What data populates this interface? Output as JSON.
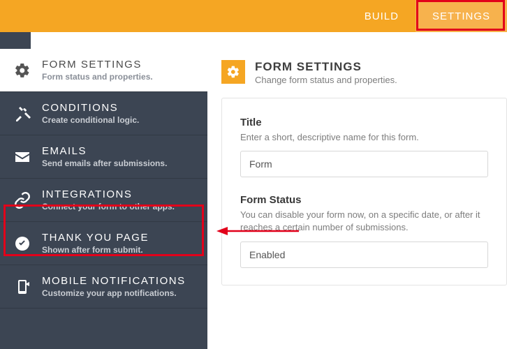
{
  "topbar": {
    "build": "BUILD",
    "settings": "SETTINGS"
  },
  "sidebar": {
    "items": [
      {
        "title": "FORM SETTINGS",
        "sub": "Form status and properties."
      },
      {
        "title": "CONDITIONS",
        "sub": "Create conditional logic."
      },
      {
        "title": "EMAILS",
        "sub": "Send emails after submissions."
      },
      {
        "title": "INTEGRATIONS",
        "sub": "Connect your form to other apps."
      },
      {
        "title": "THANK YOU PAGE",
        "sub": "Shown after form submit."
      },
      {
        "title": "MOBILE NOTIFICATIONS",
        "sub": "Customize your app notifications."
      }
    ]
  },
  "main": {
    "heading": "FORM SETTINGS",
    "subheading": "Change form status and properties.",
    "title_field": {
      "label": "Title",
      "help": "Enter a short, descriptive name for this form.",
      "value": "Form"
    },
    "status_field": {
      "label": "Form Status",
      "help": "You can disable your form now, on a specific date, or after it reaches a certain number of submissions.",
      "value": "Enabled"
    }
  }
}
